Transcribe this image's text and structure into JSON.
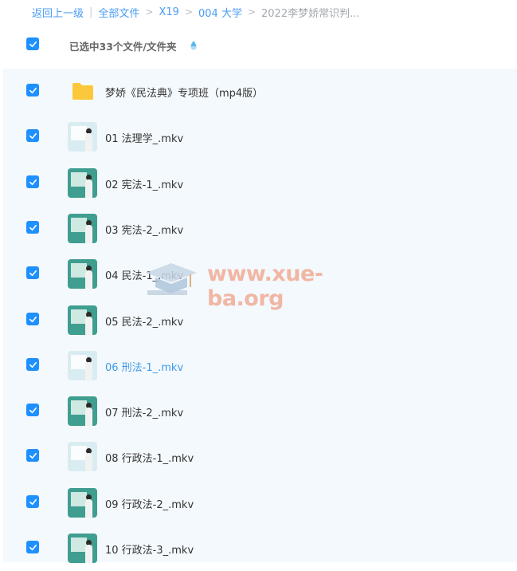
{
  "breadcrumb": {
    "back": "返回上一级",
    "items": [
      "全部文件",
      "X19",
      "004 大学"
    ],
    "current": "2022李梦娇常识判..."
  },
  "header": {
    "selected_text": "已选中33个文件/文件夹"
  },
  "rows": [
    {
      "name": "梦娇《民法典》专项班（mp4版）",
      "type": "folder"
    },
    {
      "name": "01 法理学_.mkv",
      "type": "video"
    },
    {
      "name": "02 宪法-1_.mkv",
      "type": "video"
    },
    {
      "name": "03 宪法-2_.mkv",
      "type": "video"
    },
    {
      "name": "04 民法-1_.mkv",
      "type": "video"
    },
    {
      "name": "05 民法-2_.mkv",
      "type": "video"
    },
    {
      "name": "06 刑法-1_.mkv",
      "type": "video",
      "active": true
    },
    {
      "name": "07 刑法-2_.mkv",
      "type": "video"
    },
    {
      "name": "08 行政法-1_.mkv",
      "type": "video"
    },
    {
      "name": "09 行政法-2_.mkv",
      "type": "video"
    },
    {
      "name": "10 行政法-3_.mkv",
      "type": "video"
    }
  ],
  "watermark": "www.xue-ba.org",
  "colors": {
    "accent": "#1e90ff",
    "link": "#4a9cf5",
    "active_text": "#3d9ae8",
    "list_bg": "#f4f9fd",
    "folder": "#fcc83b"
  }
}
